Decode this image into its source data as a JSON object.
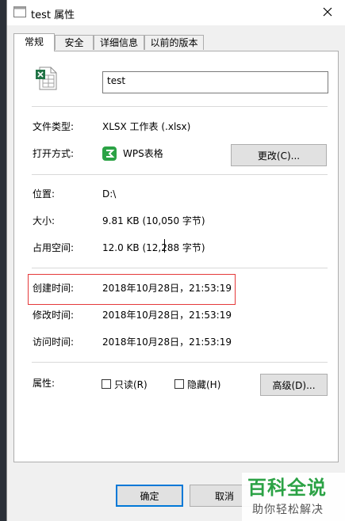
{
  "window": {
    "title": "test 属性"
  },
  "tabs": [
    {
      "label": "常规"
    },
    {
      "label": "安全"
    },
    {
      "label": "详细信息"
    },
    {
      "label": "以前的版本"
    }
  ],
  "file": {
    "name": "test",
    "icon": "excel-file-icon"
  },
  "general": {
    "type_label": "文件类型:",
    "type_value": "XLSX 工作表 (.xlsx)",
    "open_with_label": "打开方式:",
    "open_with_value": "WPS表格",
    "change_button": "更改(C)...",
    "location_label": "位置:",
    "location_value": "D:\\",
    "size_label": "大小:",
    "size_value": "9.81 KB (10,050 字节)",
    "disk_size_label": "占用空间:",
    "disk_size_value": "12.0 KB (12,288 字节)",
    "created_label": "创建时间:",
    "created_value": "2018年10月28日，21:53:19",
    "modified_label": "修改时间:",
    "modified_value": "2018年10月28日，21:53:19",
    "accessed_label": "访问时间:",
    "accessed_value": "2018年10月28日，21:53:19",
    "attributes_label": "属性:",
    "readonly_label": "只读(R)",
    "hidden_label": "隐藏(H)",
    "advanced_button": "高级(D)..."
  },
  "footer": {
    "ok_button": "确定",
    "cancel_button": "取消"
  },
  "watermark": {
    "main": "百科全说",
    "sub": "助你轻松解决"
  },
  "colors": {
    "highlight_border": "#e5393a",
    "wps_green": "#2ba245",
    "excel_green": "#217346",
    "primary_border": "#0078d7"
  }
}
